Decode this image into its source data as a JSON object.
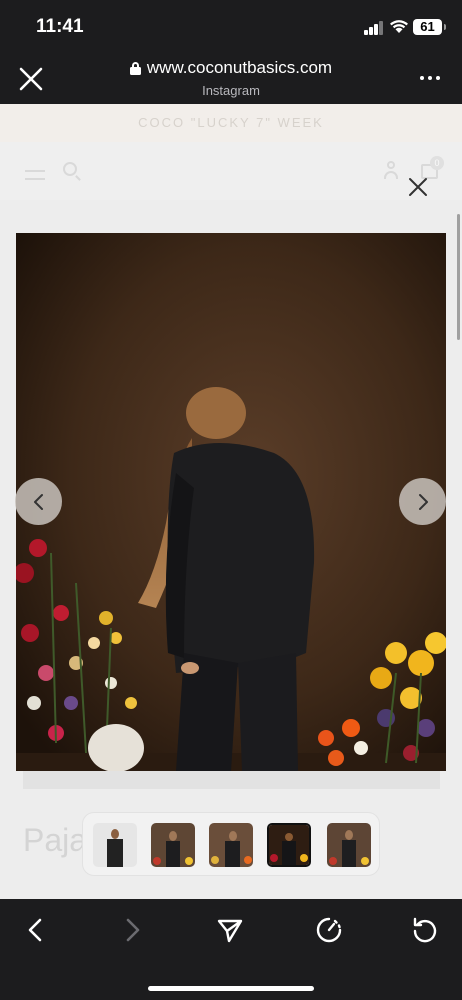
{
  "status_bar": {
    "time": "11:41",
    "battery": "61"
  },
  "browser": {
    "url": "www.coconutbasics.com",
    "source": "Instagram"
  },
  "site": {
    "announcement": "COCO \"LUCKY 7\" WEEK",
    "cart_count": "0"
  },
  "product": {
    "title_partial": "Paja",
    "gallery": {
      "selected_index": 3,
      "thumbnail_count": 5
    }
  },
  "icons": {
    "close": "close-icon",
    "lock": "lock-icon",
    "more": "more-icon",
    "menu": "hamburger-icon",
    "search": "search-icon",
    "account": "user-icon",
    "cart": "cart-icon",
    "prev": "chevron-left-icon",
    "next": "chevron-right-icon",
    "back": "back-icon",
    "forward": "forward-icon",
    "share": "send-icon",
    "speed": "speed-icon",
    "reload": "reload-icon"
  }
}
